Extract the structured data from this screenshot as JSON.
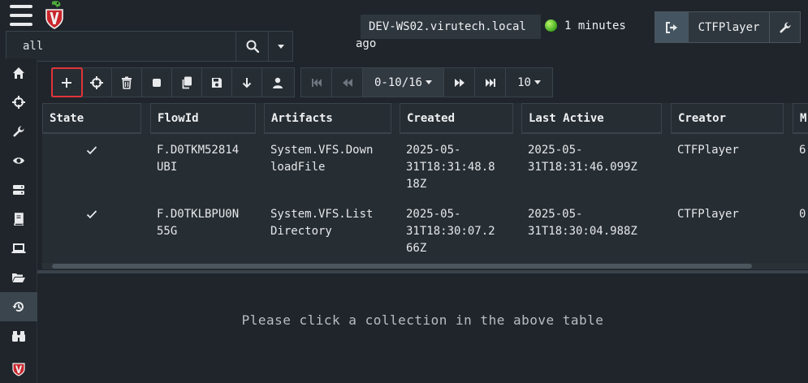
{
  "search": {
    "value": "all"
  },
  "header": {
    "hostname": "DEV-WS02.virutech.local",
    "status_line1": "1 minutes",
    "status_line2": "ago",
    "status_color": "#5fd22a",
    "username": "CTFPlayer"
  },
  "sidebar": {
    "items": [
      {
        "icon": "home-icon"
      },
      {
        "icon": "crosshair-icon"
      },
      {
        "icon": "wrench-icon"
      },
      {
        "icon": "eye-icon"
      },
      {
        "icon": "server-icon"
      },
      {
        "icon": "book-icon"
      },
      {
        "icon": "laptop-icon"
      },
      {
        "icon": "folder-open-icon"
      },
      {
        "icon": "history-icon",
        "active": true
      },
      {
        "icon": "binoculars-icon"
      },
      {
        "icon": "velociraptor-logo-icon"
      }
    ]
  },
  "toolbar": {
    "buttons": [
      "plus-icon",
      "crosshair-icon",
      "trash-icon",
      "stop-icon",
      "copy-icon",
      "save-icon",
      "download-icon",
      "user-icon"
    ]
  },
  "pager": {
    "range": "0-10/16",
    "page_size": "10"
  },
  "table": {
    "headers": [
      "State",
      "FlowId",
      "Artifacts",
      "Created",
      "Last Active",
      "Creator",
      "M"
    ],
    "rows": [
      {
        "state": "finished",
        "flow_id": [
          "F.D0TKM52814",
          "UBI"
        ],
        "artifacts": [
          "System.VFS.Down",
          "loadFile"
        ],
        "created": [
          "2025-05-",
          "31T18:31:48.8",
          "18Z"
        ],
        "last_active": [
          "2025-05-",
          "31T18:31:46.099Z"
        ],
        "creator": "CTFPlayer",
        "extra": "6"
      },
      {
        "state": "finished",
        "flow_id": [
          "F.D0TKLBPU0N",
          "55G"
        ],
        "artifacts": [
          "System.VFS.List",
          "Directory"
        ],
        "created": [
          "2025-05-",
          "31T18:30:07.2",
          "66Z"
        ],
        "last_active": [
          "2025-05-",
          "31T18:30:04.988Z"
        ],
        "creator": "CTFPlayer",
        "extra": "0"
      }
    ]
  },
  "detail": {
    "message": "Please click a collection in the above table"
  },
  "colors": {
    "accent": "#445561",
    "highlight": "#e0343a",
    "background": "#1f252b"
  }
}
